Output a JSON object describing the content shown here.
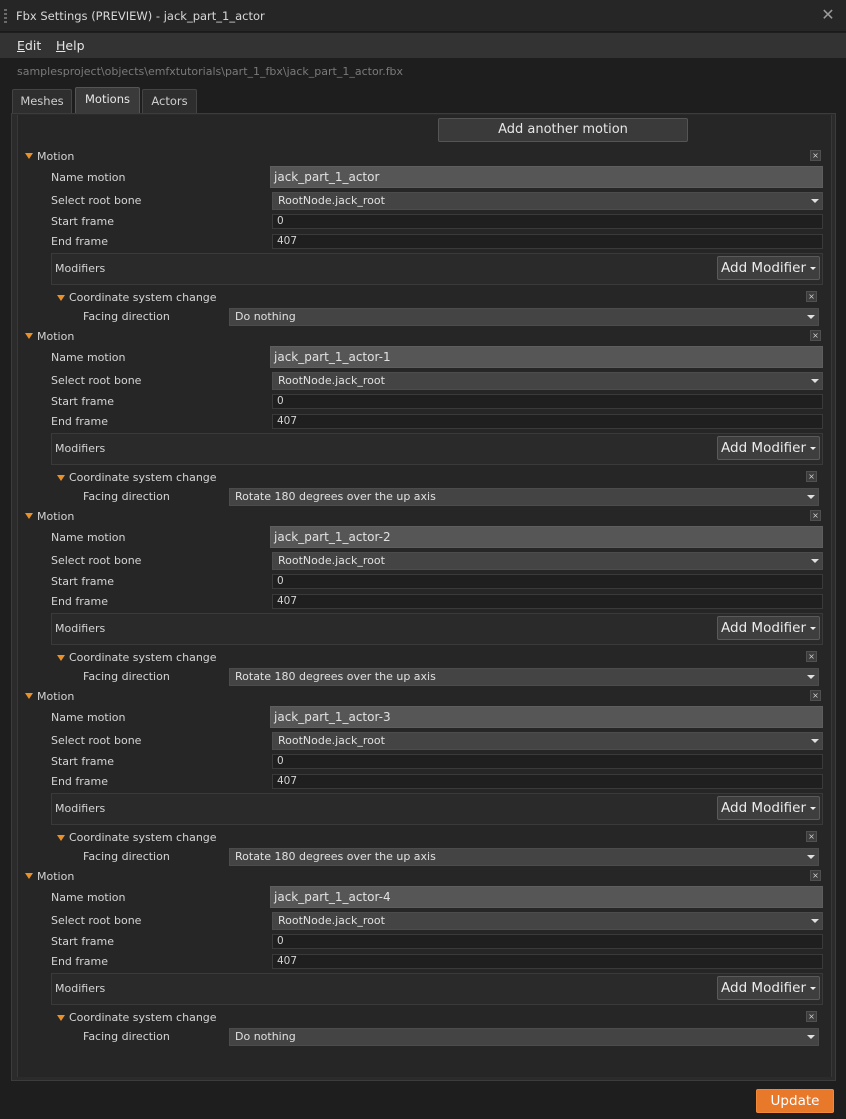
{
  "window": {
    "title": "Fbx Settings (PREVIEW) - jack_part_1_actor",
    "close_glyph": "✕"
  },
  "menu": [
    {
      "accel": "E",
      "rest": "dit"
    },
    {
      "accel": "H",
      "rest": "elp"
    }
  ],
  "file_path": "samplesproject\\objects\\emfxtutorials\\part_1_fbx\\jack_part_1_actor.fbx",
  "tabs": [
    "Meshes",
    "Motions",
    "Actors"
  ],
  "active_tab": "Motions",
  "add_motion_label": "Add another motion",
  "labels": {
    "motion": "Motion",
    "name_motion": "Name motion",
    "select_root_bone": "Select root bone",
    "start_frame": "Start frame",
    "end_frame": "End frame",
    "modifiers": "Modifiers",
    "add_modifier": "Add Modifier",
    "coord_change": "Coordinate system change",
    "facing_direction": "Facing direction",
    "remove_glyph": "×"
  },
  "motions": [
    {
      "name": "jack_part_1_actor",
      "root_bone": "RootNode.jack_root",
      "start_frame": "0",
      "end_frame": "407",
      "facing": "Do nothing"
    },
    {
      "name": "jack_part_1_actor-1",
      "root_bone": "RootNode.jack_root",
      "start_frame": "0",
      "end_frame": "407",
      "facing": "Rotate 180 degrees over the up axis"
    },
    {
      "name": "jack_part_1_actor-2",
      "root_bone": "RootNode.jack_root",
      "start_frame": "0",
      "end_frame": "407",
      "facing": "Rotate 180 degrees over the up axis"
    },
    {
      "name": "jack_part_1_actor-3",
      "root_bone": "RootNode.jack_root",
      "start_frame": "0",
      "end_frame": "407",
      "facing": "Rotate 180 degrees over the up axis"
    },
    {
      "name": "jack_part_1_actor-4",
      "root_bone": "RootNode.jack_root",
      "start_frame": "0",
      "end_frame": "407",
      "facing": "Do nothing"
    }
  ],
  "update_label": "Update",
  "colors": {
    "accent": "#e8782a",
    "triangle": "#e8912a"
  }
}
